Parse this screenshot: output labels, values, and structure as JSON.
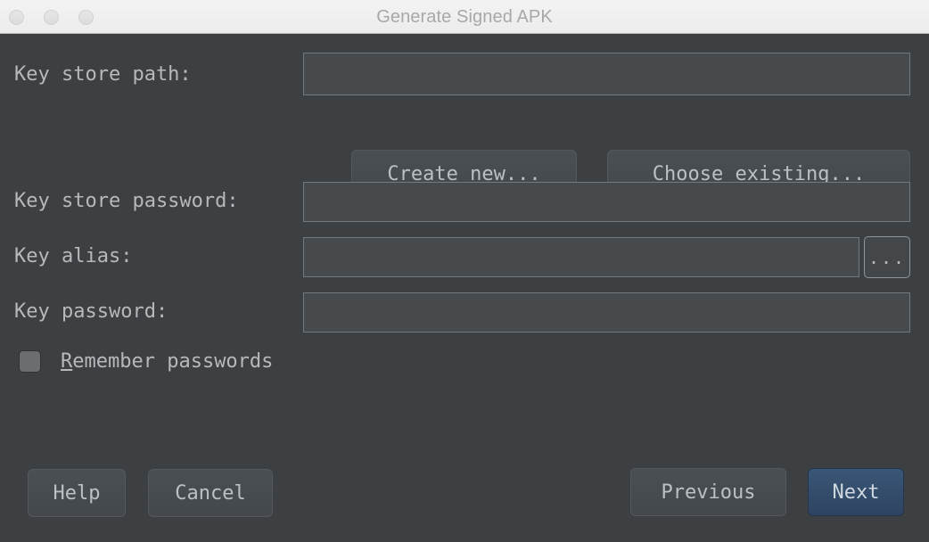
{
  "window": {
    "title": "Generate Signed APK",
    "traffic_lights": [
      {
        "name": "close-button",
        "color": "#e0e0e0"
      },
      {
        "name": "minimize-button",
        "color": "#e0e0e0"
      },
      {
        "name": "maximize-button",
        "color": "#e0e0e0"
      }
    ],
    "background_color": "#3c4043",
    "titlebar_color": "#efefef"
  },
  "form": {
    "key_store_path": {
      "label": "Key store path:",
      "value": "",
      "placeholder": ""
    },
    "key_store_password": {
      "label": "Key store password:",
      "value": "",
      "placeholder": ""
    },
    "key_alias": {
      "label": "Key alias:",
      "value": "",
      "placeholder": "",
      "browse_label": "..."
    },
    "key_password": {
      "label": "Key password:",
      "value": "",
      "placeholder": ""
    },
    "create_new_label": "Create new...",
    "choose_existing_label": "Choose existing...",
    "remember_passwords": {
      "label_mnemonic": "R",
      "label_rest": "emember passwords",
      "checked": false
    }
  },
  "footer": {
    "help_label": "Help",
    "cancel_label": "Cancel",
    "previous_label": "Previous",
    "next_label": "Next",
    "next_accent_color": "#35506f"
  }
}
